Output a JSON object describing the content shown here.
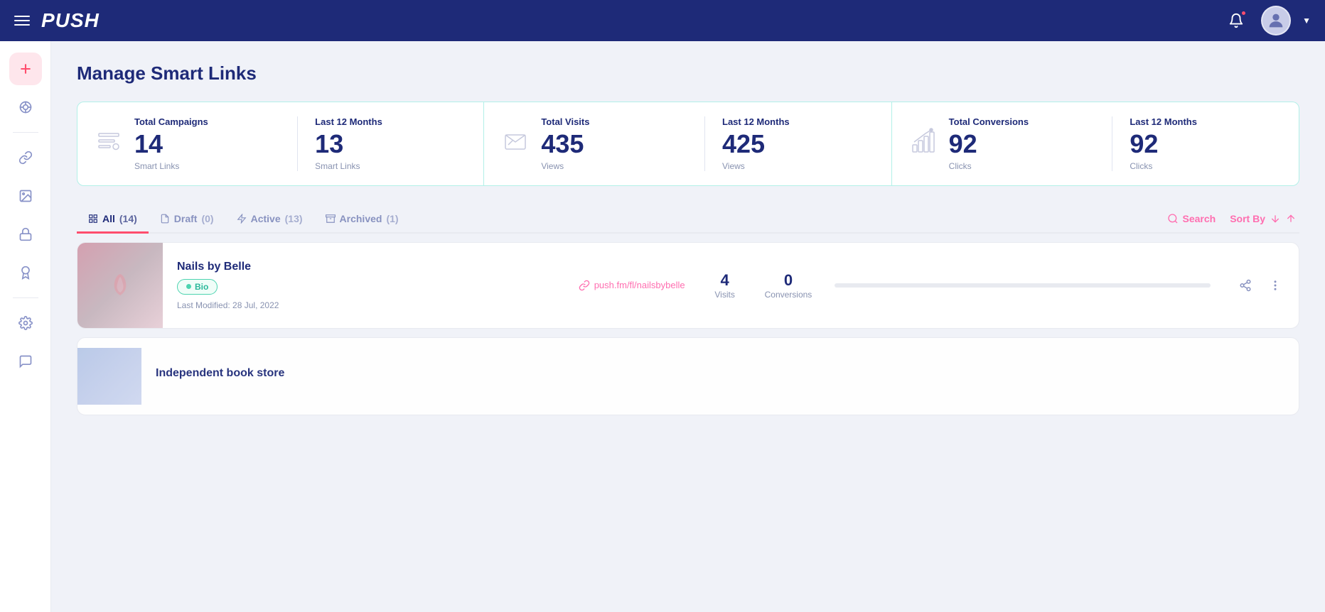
{
  "topnav": {
    "logo": "PUSH",
    "menu_aria": "menu"
  },
  "page": {
    "title": "Manage Smart Links"
  },
  "stats": [
    {
      "title": "Total Campaigns",
      "value": "14",
      "sub": "Smart Links",
      "divider_title": "Last 12 Months",
      "divider_value": "13",
      "divider_sub": "Smart Links"
    },
    {
      "title": "Total Visits",
      "value": "435",
      "sub": "Views",
      "divider_title": "Last 12 Months",
      "divider_value": "425",
      "divider_sub": "Views"
    },
    {
      "title": "Total Conversions",
      "value": "92",
      "sub": "Clicks",
      "divider_title": "Last 12 Months",
      "divider_value": "92",
      "divider_sub": "Clicks"
    }
  ],
  "tabs": [
    {
      "label": "All",
      "count": "14",
      "active": true
    },
    {
      "label": "Draft",
      "count": "0",
      "active": false
    },
    {
      "label": "Active",
      "count": "13",
      "active": false
    },
    {
      "label": "Archived",
      "count": "1",
      "active": false
    }
  ],
  "tab_actions": {
    "search_label": "Search",
    "sort_label": "Sort By"
  },
  "links": [
    {
      "name": "Nails by Belle",
      "badge": "Bio",
      "url": "push.fm/fl/nailsbybelle",
      "visits": "4",
      "conversions": "0",
      "modified": "Last Modified: 28 Jul, 2022"
    },
    {
      "name": "Independent book store",
      "badge": "",
      "url": "",
      "visits": "",
      "conversions": "",
      "modified": ""
    }
  ],
  "sidebar": {
    "items": [
      {
        "icon": "plus",
        "active": true,
        "name": "add"
      },
      {
        "icon": "grid",
        "active": false,
        "name": "dashboard"
      },
      {
        "icon": "link",
        "active": false,
        "name": "links"
      },
      {
        "icon": "image",
        "active": false,
        "name": "media"
      },
      {
        "icon": "lock",
        "active": false,
        "name": "security"
      },
      {
        "icon": "trophy",
        "active": false,
        "name": "awards"
      },
      {
        "icon": "gear",
        "active": false,
        "name": "settings"
      },
      {
        "icon": "chat",
        "active": false,
        "name": "messages"
      }
    ]
  }
}
